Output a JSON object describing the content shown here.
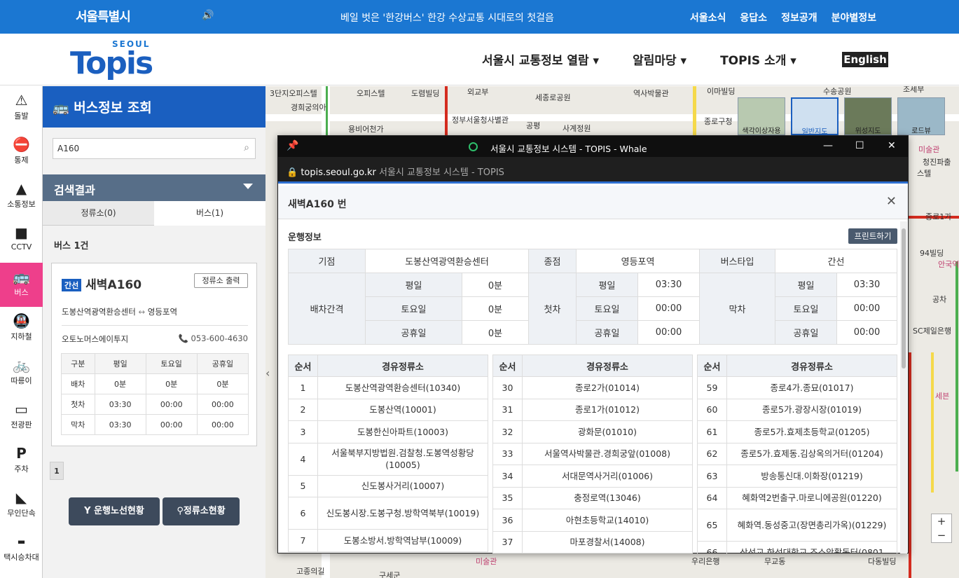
{
  "topbar": {
    "logo": "서울특별시",
    "banner": "베일 벗은 '한강버스' 한강 수상교통 시대로의 첫걸음",
    "links": [
      "서울소식",
      "응답소",
      "정보공개",
      "분야별정보"
    ]
  },
  "header": {
    "brand_small": "SEOUL",
    "brand_big": "Topis",
    "nav": [
      "서울시 교통정보 열람",
      "알림마당",
      "TOPIS 소개"
    ],
    "english": "English"
  },
  "leftnav": [
    {
      "label": "돌발",
      "icon": "alert-icon"
    },
    {
      "label": "통제",
      "icon": "no-entry-icon"
    },
    {
      "label": "소통정보",
      "icon": "road-icon"
    },
    {
      "label": "CCTV",
      "icon": "camera-icon"
    },
    {
      "label": "버스",
      "icon": "bus-icon"
    },
    {
      "label": "지하철",
      "icon": "subway-icon"
    },
    {
      "label": "따릉이",
      "icon": "bicycle-icon"
    },
    {
      "label": "전광판",
      "icon": "signboard-icon"
    },
    {
      "label": "주차",
      "icon": "parking-icon"
    },
    {
      "label": "무인단속",
      "icon": "speed-camera-icon"
    },
    {
      "label": "택시승차대",
      "icon": "taxi-icon"
    }
  ],
  "panel": {
    "title": "버스정보 조회",
    "search_value": "A160",
    "results_title": "검색결과",
    "tab_stops": "정류소(0)",
    "tab_bus": "버스(1)",
    "count": "버스 1건",
    "card": {
      "badge": "간선",
      "route": "새벽A160",
      "print_btn": "정류소 출력",
      "start": "도봉산역광역환승센터",
      "arrow": "↔",
      "end": "영등포역",
      "company": "오토노머스에이투지",
      "phone": "053-600-4630",
      "table": [
        [
          "구분",
          "평일",
          "토요일",
          "공휴일"
        ],
        [
          "배차",
          "0분",
          "0분",
          "0분"
        ],
        [
          "첫차",
          "03:30",
          "00:00",
          "00:00"
        ],
        [
          "막차",
          "03:30",
          "00:00",
          "00:00"
        ]
      ]
    },
    "page": "1",
    "btn_route": "운행노선현황",
    "btn_stops": "정류소현황"
  },
  "map": {
    "thumbs": [
      "색각이상자용",
      "일반지도",
      "위성지도",
      "로드뷰"
    ],
    "labels": [
      "3단지오피스텔",
      "오피스텔",
      "도렴빌딩",
      "외교부",
      "세종로공원",
      "역사박물관",
      "이마빌딩",
      "수송공원",
      "조세부",
      "경희궁의아",
      "용비어천가",
      "정부서울청사별관",
      "공평",
      "사계정원",
      "종로구청",
      "미술관",
      "청진파출",
      "스텔",
      "종로1가",
      "94빌딩",
      "안국역",
      "공차",
      "SC제일은행",
      "세븐",
      "미술관",
      "고종의길",
      "구세군",
      "우리은행",
      "무교동",
      "다동빌딩"
    ],
    "zoom_in": "+",
    "zoom_out": "−"
  },
  "popup": {
    "window_title": "서울시 교통정보 시스템 - TOPIS - Whale",
    "url_host": "topis.seoul.go.kr",
    "url_title": "서울시 교통정보 시스템 - TOPIS",
    "header": "새벽A160 번",
    "section": "운행정보",
    "print": "프린트하기",
    "info": {
      "start_label": "기점",
      "start_value": "도봉산역광역환승센터",
      "end_label": "종점",
      "end_value": "영등포역",
      "type_label": "버스타입",
      "type_value": "간선",
      "interval_label": "배차간격",
      "first_label": "첫차",
      "last_label": "막차",
      "day_labels": [
        "평일",
        "토요일",
        "공휴일"
      ],
      "interval": [
        "0분",
        "0분",
        "0분"
      ],
      "first": [
        "03:30",
        "00:00",
        "00:00"
      ],
      "last": [
        "03:30",
        "00:00",
        "00:00"
      ]
    },
    "stops_headers": [
      "순서",
      "경유정류소"
    ],
    "stops_col1": [
      [
        "1",
        "도봉산역광역환승센터(10340)"
      ],
      [
        "2",
        "도봉산역(10001)"
      ],
      [
        "3",
        "도봉한신아파트(10003)"
      ],
      [
        "4",
        "서울북부지방법원.검찰청.도봉역성황당(10005)"
      ],
      [
        "5",
        "신도봉사거리(10007)"
      ],
      [
        "6",
        "신도봉시장.도봉구청.방학역북부(10019)"
      ],
      [
        "7",
        "도봉소방서.방학역남부(10009)"
      ]
    ],
    "stops_col2": [
      [
        "30",
        "종로2가(01014)"
      ],
      [
        "31",
        "종로1가(01012)"
      ],
      [
        "32",
        "광화문(01010)"
      ],
      [
        "33",
        "서울역사박물관.경희궁앞(01008)"
      ],
      [
        "34",
        "서대문역사거리(01006)"
      ],
      [
        "35",
        "충정로역(13046)"
      ],
      [
        "36",
        "아현초등학교(14010)"
      ],
      [
        "37",
        "마포경찰서(14008)"
      ]
    ],
    "stops_col3": [
      [
        "59",
        "종로4가.종묘(01017)"
      ],
      [
        "60",
        "종로5가.광장시장(01019)"
      ],
      [
        "61",
        "종로5가.효제초등학교(01205)"
      ],
      [
        "62",
        "종로5가.효제동.김상옥의거터(01204)"
      ],
      [
        "63",
        "방송통신대.이화장(01219)"
      ],
      [
        "64",
        "혜화역2번출구.마로니에공원(01220)"
      ],
      [
        "65",
        "혜화역.동성중고(장면총리가옥)(01229)"
      ],
      [
        "66",
        "삼선교.한성대학교.조소앙활동터(0801"
      ]
    ]
  }
}
